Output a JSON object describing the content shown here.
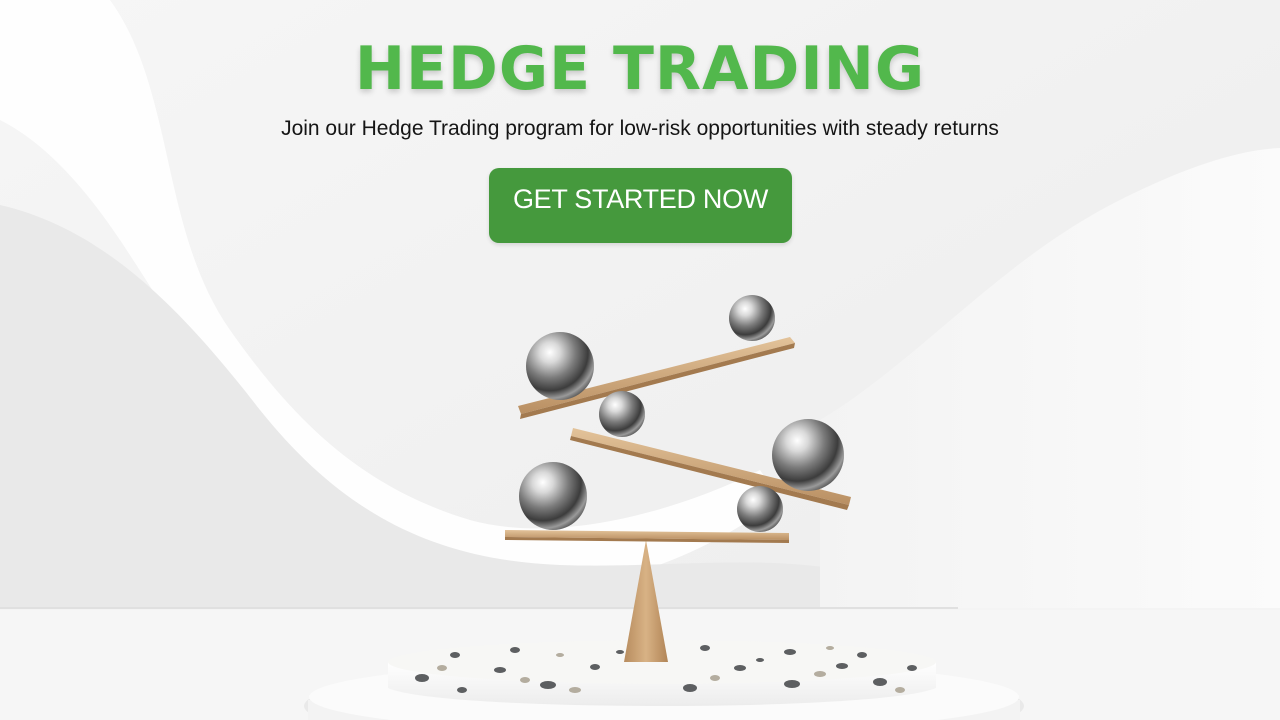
{
  "hero": {
    "title": "HEDGE TRADING",
    "subtitle": "Join our Hedge Trading program for low-risk opportunities with steady returns",
    "cta_label": "GET STARTED NOW"
  },
  "colors": {
    "title_green": "#52b84c",
    "button_green": "#45993d",
    "background": "#f0f0f0",
    "plank_wood": "#cfa779",
    "terrazzo_base": "#f4f4f2"
  },
  "illustration": {
    "subject": "balance-scale-with-steel-balls",
    "plank_count": 3,
    "ball_count": 6
  }
}
